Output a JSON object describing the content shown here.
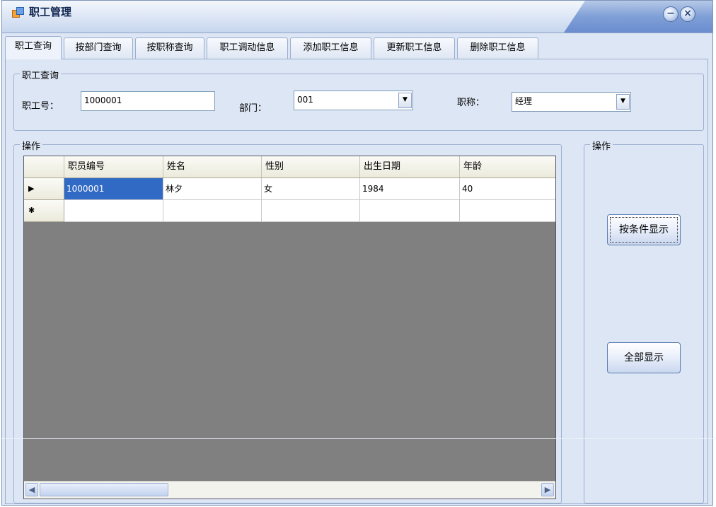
{
  "window": {
    "title": "职工管理"
  },
  "tabs": [
    {
      "label": "职工查询",
      "active": true
    },
    {
      "label": "按部门查询"
    },
    {
      "label": "按职称查询"
    },
    {
      "label": "职工调动信息"
    },
    {
      "label": "添加职工信息"
    },
    {
      "label": "更新职工信息"
    },
    {
      "label": "删除职工信息"
    }
  ],
  "query": {
    "legend": "职工查询",
    "employee_no_label": "职工号：",
    "employee_no_value": "1000001",
    "dept_label": "部门：",
    "dept_value": "001",
    "title_label": "职称：",
    "title_value": "经理"
  },
  "ops_left": {
    "legend": "操作"
  },
  "ops_right": {
    "legend": "操作",
    "btn_by_condition": "按条件显示",
    "btn_show_all": "全部显示"
  },
  "grid": {
    "columns": [
      "职员编号",
      "姓名",
      "性别",
      "出生日期",
      "年龄"
    ],
    "rows": [
      {
        "marker": "▶",
        "cells": [
          "1000001",
          "林夕",
          "女",
          "1984",
          "40"
        ]
      },
      {
        "marker": "✱",
        "cells": [
          "",
          "",
          "",
          "",
          ""
        ]
      }
    ]
  },
  "icons": {
    "minimize": "minimize-icon",
    "close": "close-icon",
    "dropdown": "chevron-down-icon",
    "scroll_left": "arrow-left-icon",
    "scroll_right": "arrow-right-icon"
  },
  "colors": {
    "selection": "#316ac5",
    "grid_background": "#808080"
  }
}
